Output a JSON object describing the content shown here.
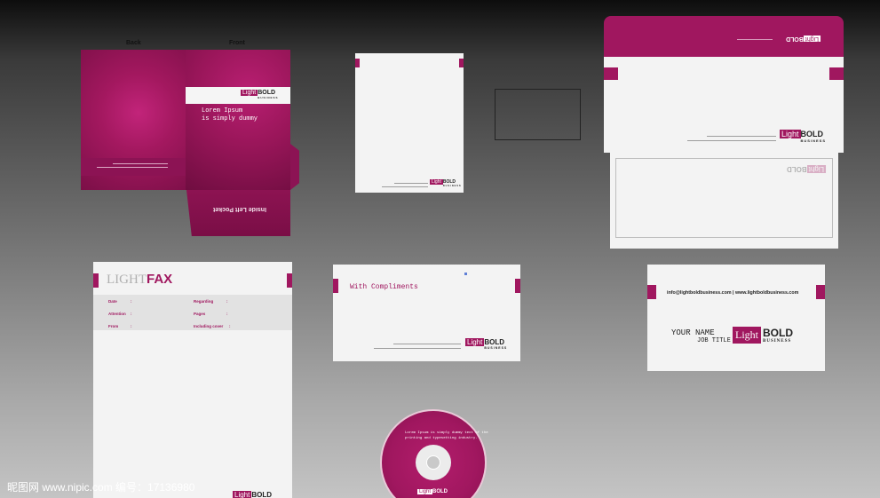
{
  "colors": {
    "brand": "#a0175f",
    "paper": "#f3f3f3",
    "dark": "#222222"
  },
  "folder": {
    "back_label": "Back",
    "front_label": "Front",
    "headline_1": "Lorem Ipsum",
    "headline_2": "is simply dummy",
    "pocket_label": "Inside Left Pocket"
  },
  "logo": {
    "light": "Light",
    "bold": "BOLD",
    "business": "BUSINESS"
  },
  "fax": {
    "title_light": "LIGHT",
    "title_bold": "FAX",
    "fields_left": [
      "Date",
      "Attention",
      "From"
    ],
    "fields_right": [
      "Regarding",
      "Pages",
      "Including cover"
    ],
    "colon": ":"
  },
  "slip": {
    "title": "With Compliments"
  },
  "card": {
    "contact": "info@lightboldbusiness.com | www.lightboldbusiness.com",
    "name": "YOUR NAME",
    "job": "JOB TITLE"
  },
  "cd": {
    "text": "Lorem Ipsum is simply dummy text of the printing and typesetting industry."
  },
  "watermark": "昵图网 www.nipic.com  编号：17136980"
}
